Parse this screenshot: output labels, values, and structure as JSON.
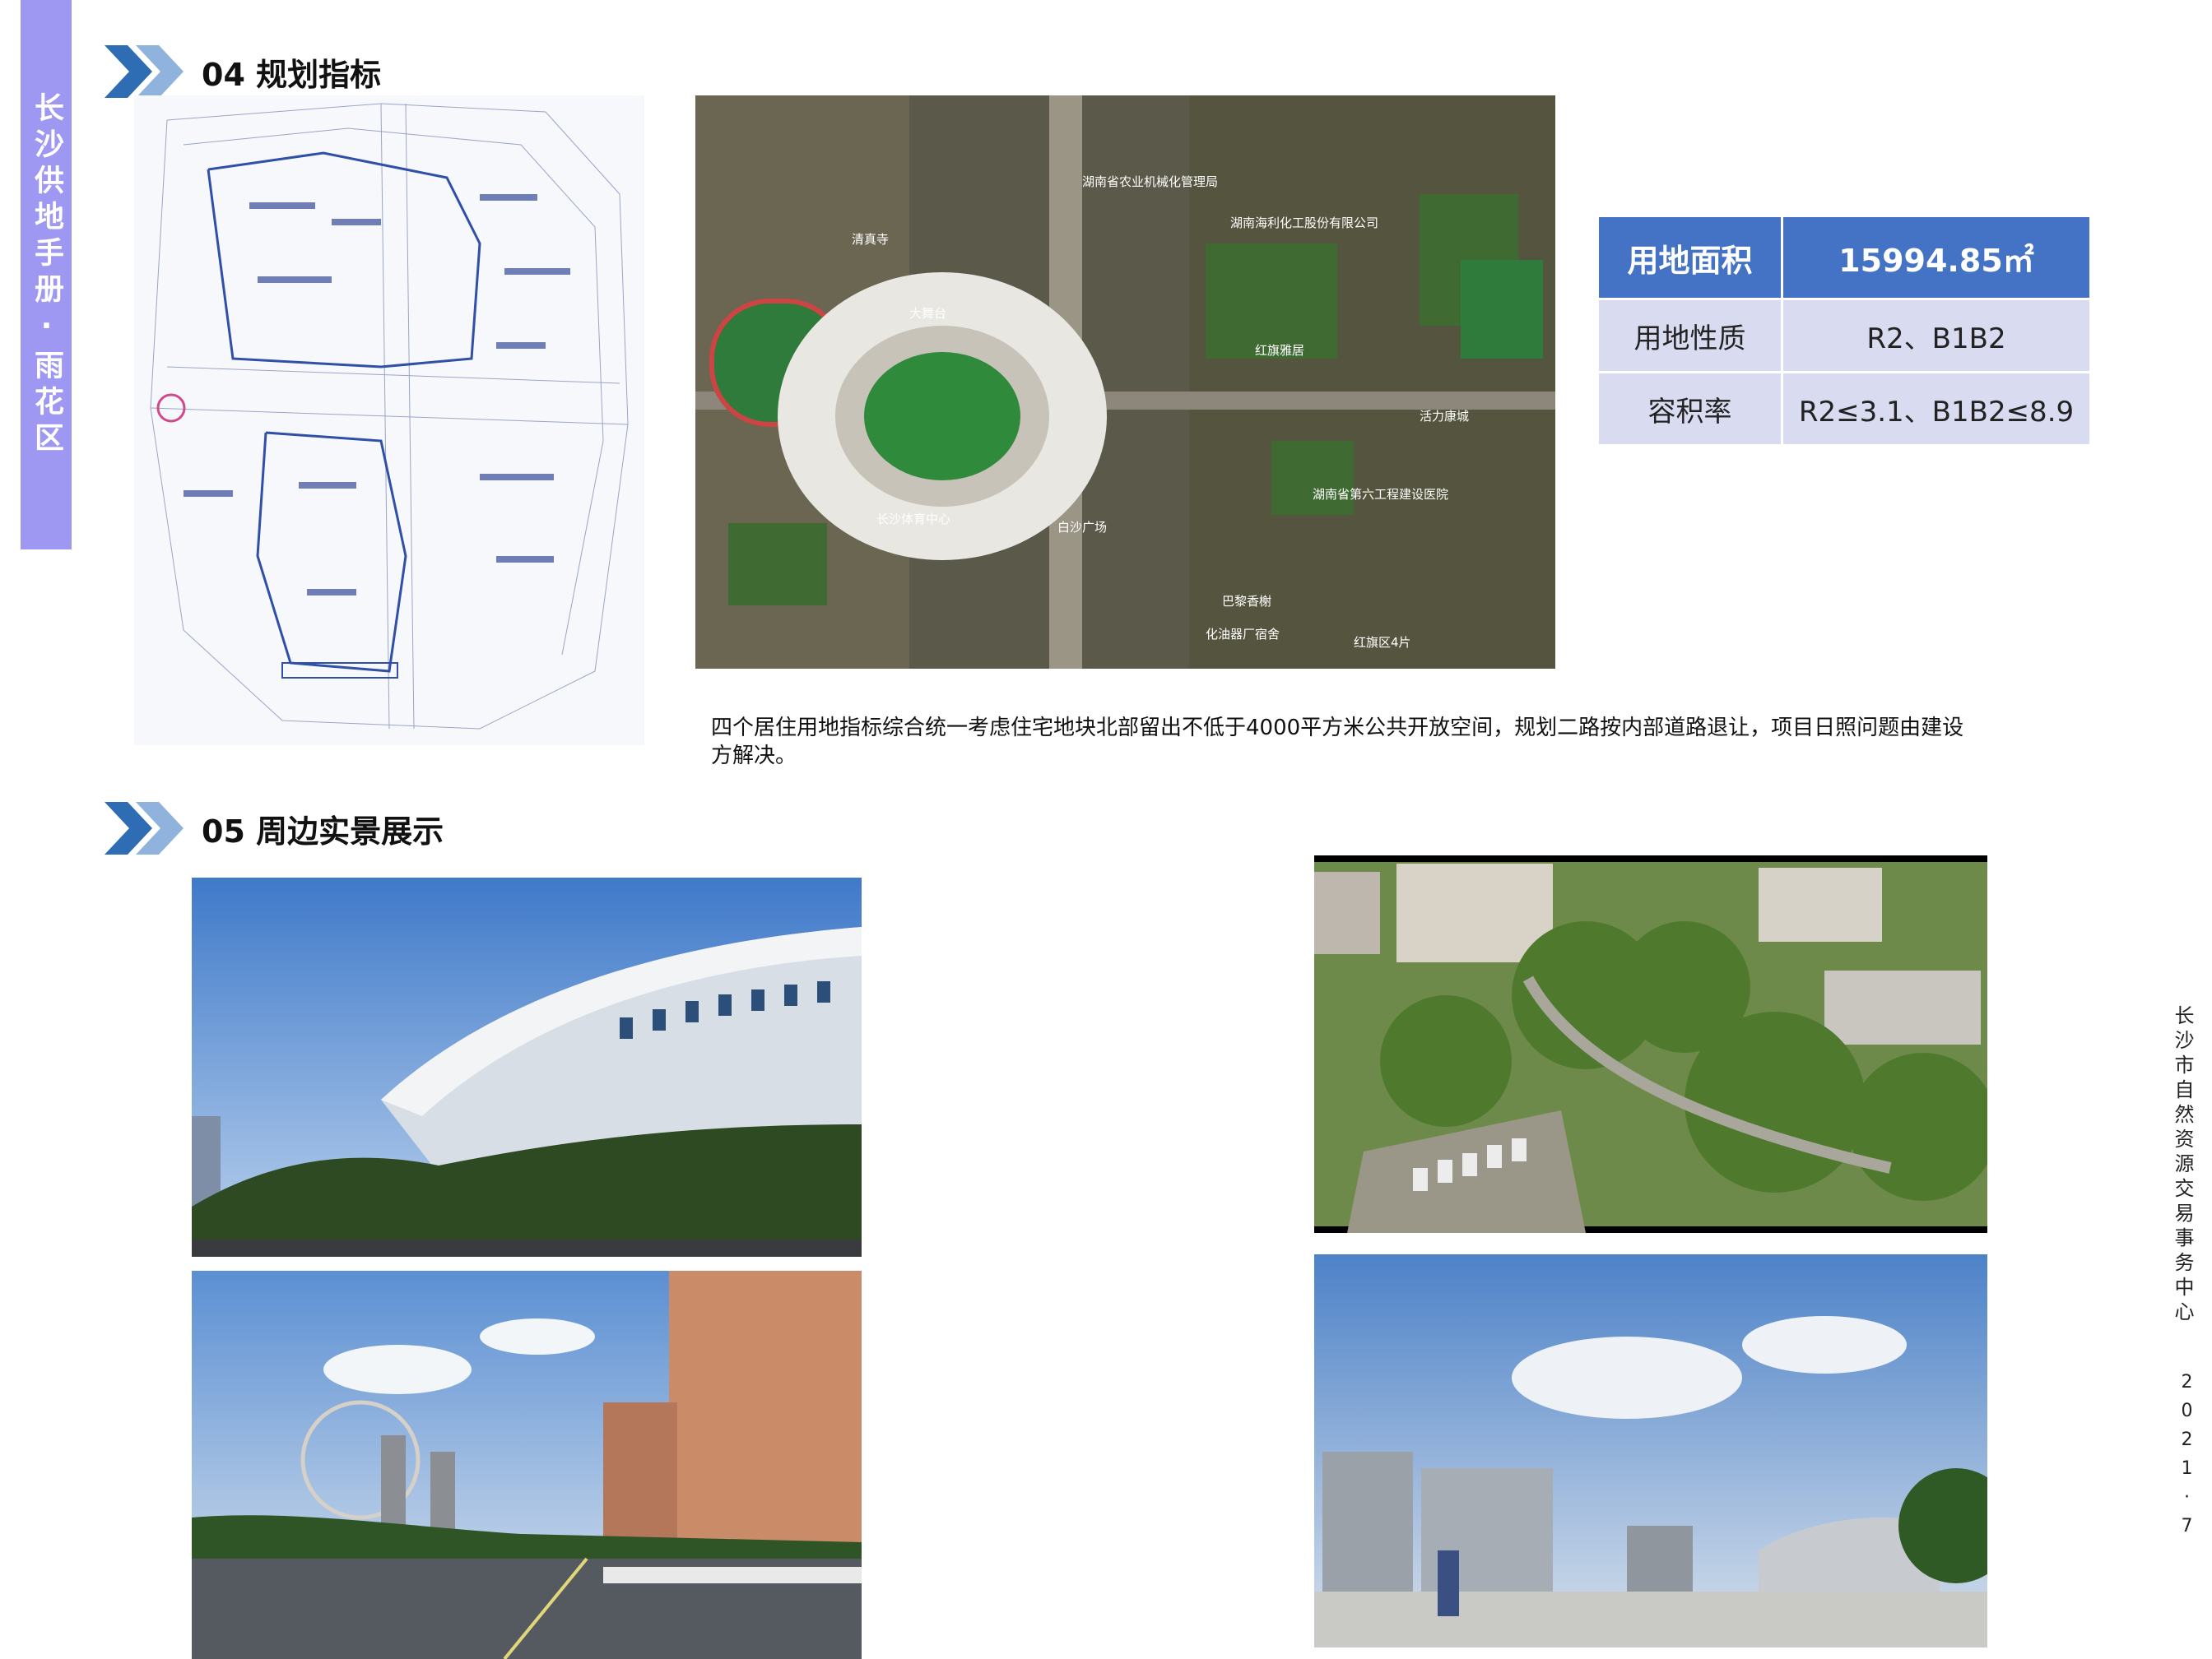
{
  "sidebar": {
    "title": "长沙供地手册·雨花区"
  },
  "section04": {
    "title": "04 规划指标"
  },
  "section05": {
    "title": "05 周边实景展示"
  },
  "metrics": {
    "area_label": "用地面积",
    "area_value": "15994.85㎡",
    "use_label": "用地性质",
    "use_value": "R2、B1B2",
    "far_label": "容积率",
    "far_value": "R2≤3.1、B1B2≤8.9"
  },
  "note": "四个居住用地指标综合统一考虑住宅地块北部留出不低于4000平方米公共开放空间，规划二路按内部道路退让，项目日照问题由建设方解决。",
  "map_labels": {
    "l1": "湖南省农业机械化管理局",
    "l2": "湖南海利化工股份有限公司",
    "l3": "红旗雅居",
    "l4": "长沙体育中心",
    "l5": "白沙广场",
    "l6": "湖南省第六工程建设医院",
    "l7": "活力康城",
    "l8": "化油器厂宿舍",
    "l9": "巴黎香榭",
    "l10": "红旗区4片",
    "l11": "清真寺",
    "l12": "大舞台"
  },
  "footer": {
    "org": "长沙市自然资源交易事务中心",
    "date": "2021·7"
  },
  "colors": {
    "sidebar": "#9e98f3",
    "table_header": "#4472c4",
    "table_row": "#d9dcf1",
    "arrow_dark": "#2e6db4",
    "arrow_light": "#8fb3dd"
  }
}
